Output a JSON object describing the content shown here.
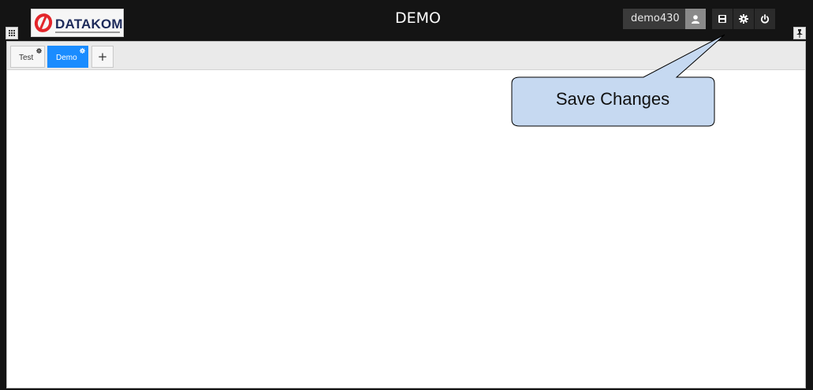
{
  "header": {
    "logo_text": "DATAKOM",
    "title": "DEMO",
    "username": "demo430",
    "icons": {
      "apps": "grid-icon",
      "user": "user-icon",
      "save": "save-icon",
      "settings": "gear-icon",
      "logout": "power-icon",
      "pin": "pin-icon"
    }
  },
  "tabs": [
    {
      "label": "Test",
      "active": false
    },
    {
      "label": "Demo",
      "active": true
    }
  ],
  "add_tab_label": "+",
  "callout": {
    "text": "Save Changes"
  },
  "colors": {
    "frame": "#141414",
    "active_tab": "#1a8cff",
    "callout_fill": "#c6d9f1"
  }
}
